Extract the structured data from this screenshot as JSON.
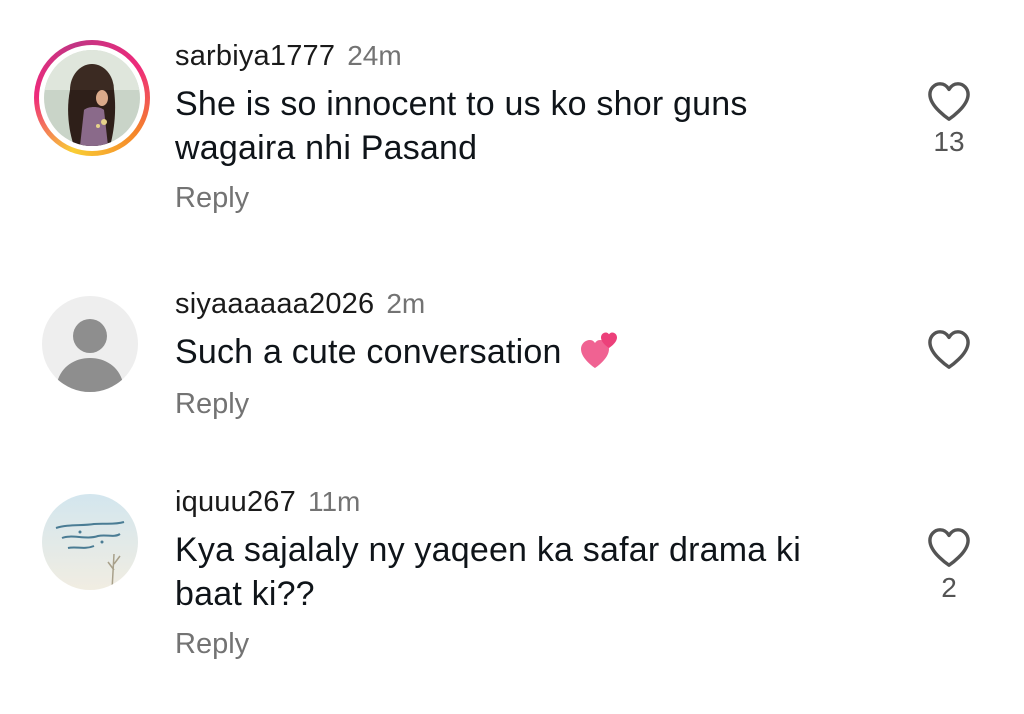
{
  "comments": [
    {
      "username": "sarbiya1777",
      "time": "24m",
      "text": "She is so innocent to us ko shor guns wagaira nhi Pasand",
      "reply_label": "Reply",
      "likes": "13",
      "avatar": "photo-avatar-with-story-ring"
    },
    {
      "username": "siyaaaaaa2026",
      "time": "2m",
      "text": "Such a cute conversation",
      "emoji": "two-hearts-icon",
      "reply_label": "Reply",
      "likes": "",
      "avatar": "default-avatar"
    },
    {
      "username": "iquuu267",
      "time": "11m",
      "text": "Kya sajalaly ny yaqeen ka safar drama ki baat ki??",
      "reply_label": "Reply",
      "likes": "2",
      "avatar": "calligraphy-image-avatar"
    }
  ],
  "colors": {
    "ring_start": "#f9ce34",
    "ring_mid": "#ee2a7b",
    "ring_end": "#c13584",
    "secondary_text": "#737373",
    "heart_outline": "#545454",
    "emoji_pink": "#f06292"
  }
}
